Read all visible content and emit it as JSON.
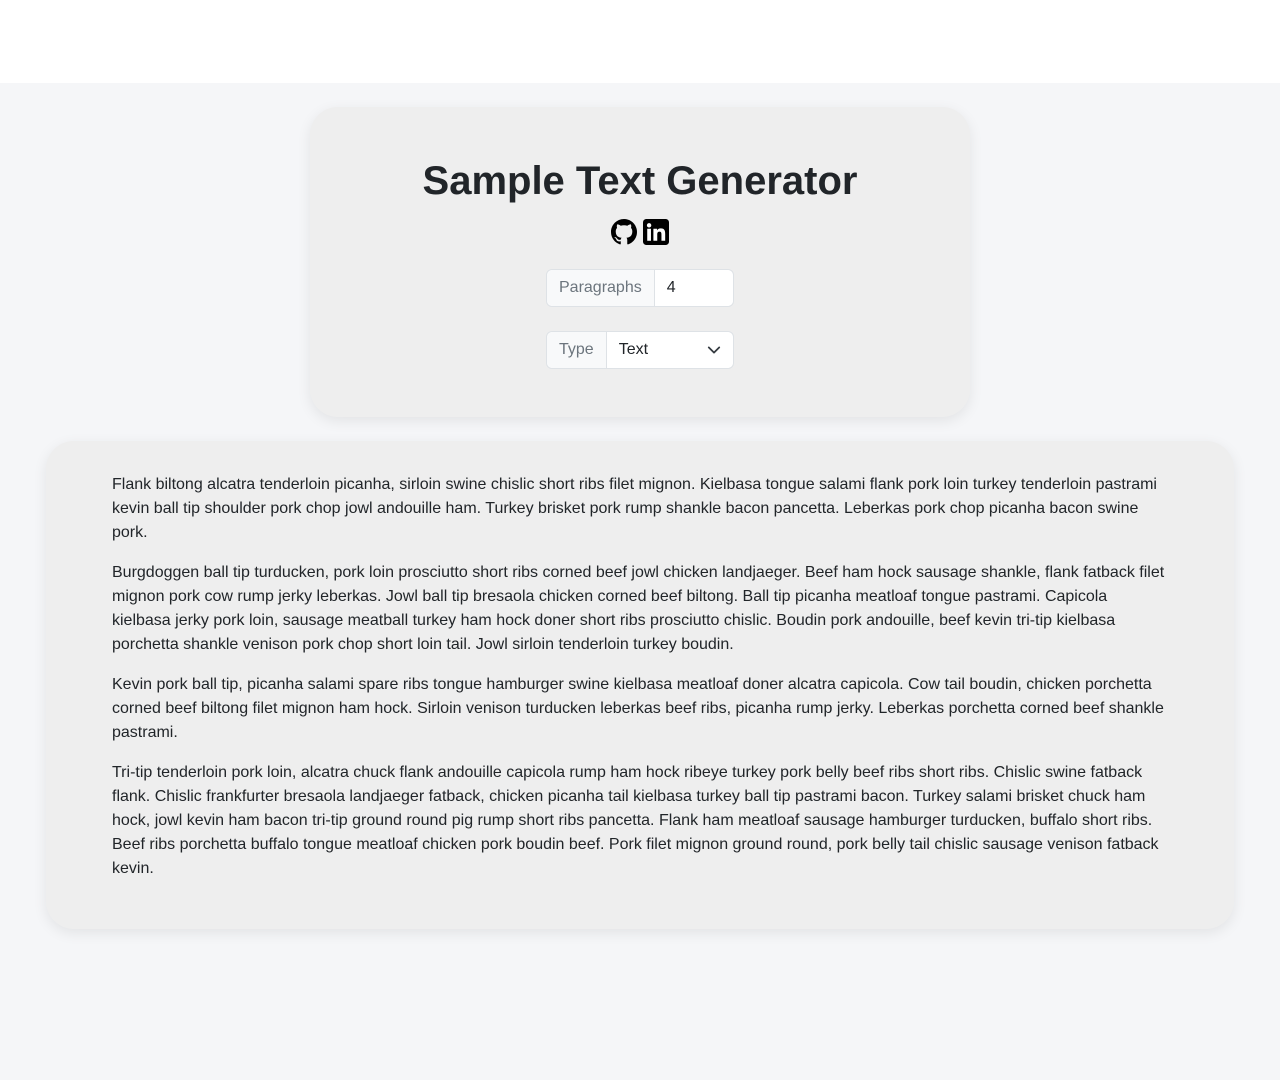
{
  "header": {
    "title": "Sample Text Generator",
    "social_icons": [
      "github-icon",
      "linkedin-icon"
    ]
  },
  "controls": {
    "paragraphs_label": "Paragraphs",
    "paragraphs_value": "4",
    "type_label": "Type",
    "type_value": "Text"
  },
  "content": {
    "paragraphs": [
      "Flank biltong alcatra tenderloin picanha, sirloin swine chislic short ribs filet mignon. Kielbasa tongue salami flank pork loin turkey tenderloin pastrami kevin ball tip shoulder pork chop jowl andouille ham. Turkey brisket pork rump shankle bacon pancetta. Leberkas pork chop picanha bacon swine pork.",
      "Burgdoggen ball tip turducken, pork loin prosciutto short ribs corned beef jowl chicken landjaeger. Beef ham hock sausage shankle, flank fatback filet mignon pork cow rump jerky leberkas. Jowl ball tip bresaola chicken corned beef biltong. Ball tip picanha meatloaf tongue pastrami. Capicola kielbasa jerky pork loin, sausage meatball turkey ham hock doner short ribs prosciutto chislic. Boudin pork andouille, beef kevin tri-tip kielbasa porchetta shankle venison pork chop short loin tail. Jowl sirloin tenderloin turkey boudin.",
      "Kevin pork ball tip, picanha salami spare ribs tongue hamburger swine kielbasa meatloaf doner alcatra capicola. Cow tail boudin, chicken porchetta corned beef biltong filet mignon ham hock. Sirloin venison turducken leberkas beef ribs, picanha rump jerky. Leberkas porchetta corned beef shankle pastrami.",
      "Tri-tip tenderloin pork loin, alcatra chuck flank andouille capicola rump ham hock ribeye turkey pork belly beef ribs short ribs. Chislic swine fatback flank. Chislic frankfurter bresaola landjaeger fatback, chicken picanha tail kielbasa turkey ball tip pastrami bacon. Turkey salami brisket chuck ham hock, jowl kevin ham bacon tri-tip ground round pig rump short ribs pancetta. Flank ham meatloaf sausage hamburger turducken, buffalo short ribs. Beef ribs porchetta buffalo tongue meatloaf chicken pork boudin beef. Pork filet mignon ground round, pork belly tail chislic sausage venison fatback kevin."
    ]
  },
  "colors": {
    "page_background": "#f5f6f8",
    "card_background": "#eeeeee",
    "text": "#212529",
    "muted_text": "#6c757d"
  }
}
